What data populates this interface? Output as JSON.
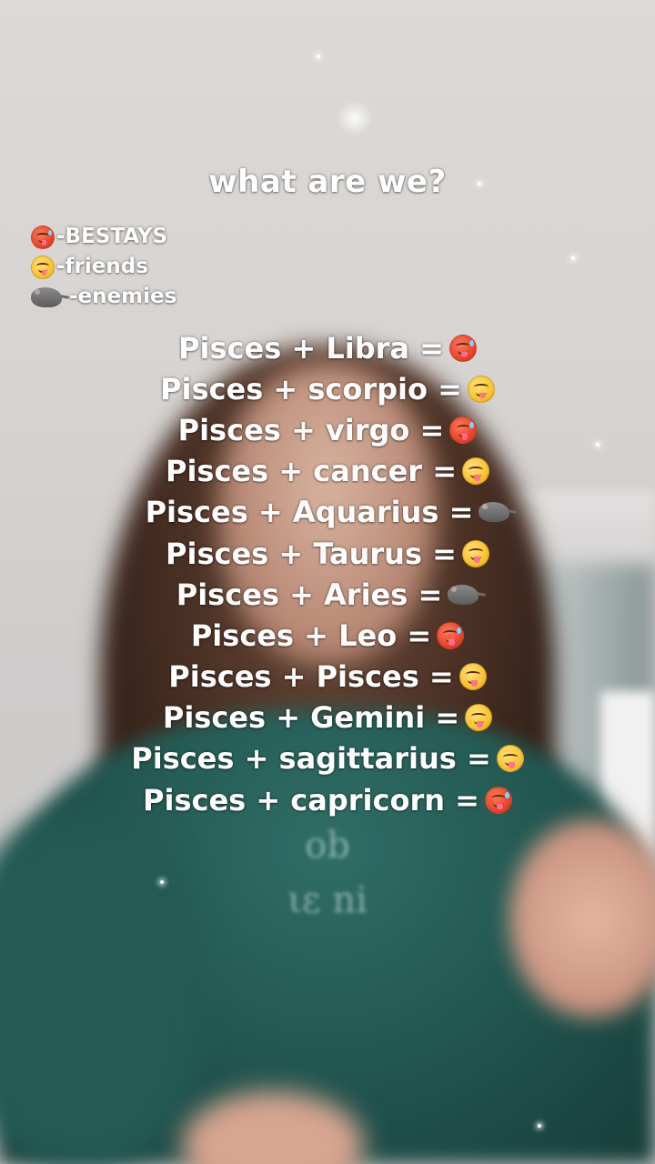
{
  "title": "what are we?",
  "legend": [
    {
      "icon": "hot-face-emoji",
      "label": "-BESTAYS"
    },
    {
      "icon": "yum-face-emoji",
      "label": "-friends"
    },
    {
      "icon": "rat-emoji",
      "label": "-enemies"
    }
  ],
  "pairs": [
    {
      "text": "Pisces + Libra = ",
      "icon": "hot-face-emoji"
    },
    {
      "text": "Pisces + scorpio = ",
      "icon": "yum-face-emoji"
    },
    {
      "text": "Pisces + virgo = ",
      "icon": "hot-face-emoji"
    },
    {
      "text": "Pisces + cancer =",
      "icon": "yum-face-emoji"
    },
    {
      "text": "Pisces + Aquarius = ",
      "icon": "rat-emoji"
    },
    {
      "text": "Pisces + Taurus = ",
      "icon": "yum-face-emoji"
    },
    {
      "text": "Pisces + Aries = ",
      "icon": "rat-emoji"
    },
    {
      "text": "Pisces + Leo = ",
      "icon": "hot-face-emoji"
    },
    {
      "text": "Pisces + Pisces = ",
      "icon": "yum-face-emoji"
    },
    {
      "text": "Pisces + Gemini = ",
      "icon": "yum-face-emoji"
    },
    {
      "text": "Pisces + sagittarius = ",
      "icon": "yum-face-emoji"
    },
    {
      "text": "Pisces + capricorn = ",
      "icon": "hot-face-emoji"
    }
  ]
}
